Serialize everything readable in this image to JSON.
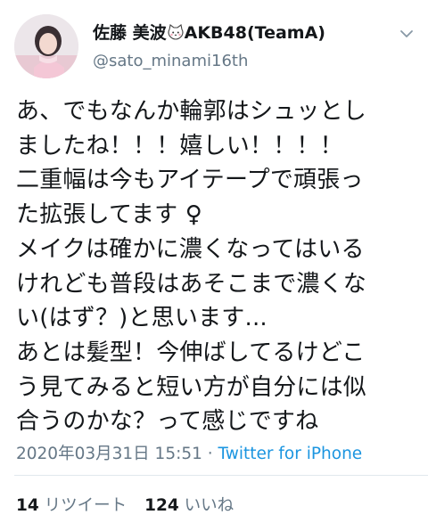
{
  "user": {
    "display_name_prefix": "佐藤 美波",
    "display_name_suffix": "AKB48(TeamA)",
    "name_icon": "cat-emoji-icon",
    "handle": "@sato_minami16th",
    "avatar": "profile-photo"
  },
  "menu": {
    "icon": "chevron-down-icon"
  },
  "tweet": {
    "lines": [
      "あ、でもなんか輪郭はシュッとし",
      "ましたね！！！嬉しい！！！！",
      "二重幅は今もアイテープで頑張っ",
      "た拡張してます ♀",
      "メイクは確かに濃くなってはいる",
      "けれども普段はあそこまで濃くな",
      "い(はず？)と思います...",
      "あとは髪型！今伸ばしてるけどこ",
      "う見てみると短い方が自分には似",
      "合うのかな？って感じですね"
    ]
  },
  "meta": {
    "timestamp": "2020年03月31日 15:51",
    "separator": "·",
    "source": "Twitter for iPhone"
  },
  "stats": {
    "retweet_count": "14",
    "retweet_label": "リツイート",
    "like_count": "124",
    "like_label": "いいね"
  },
  "colors": {
    "link": "#1b95e0",
    "secondary_text": "#657786",
    "primary_text": "#14171a",
    "divider": "#e1e8ed"
  }
}
